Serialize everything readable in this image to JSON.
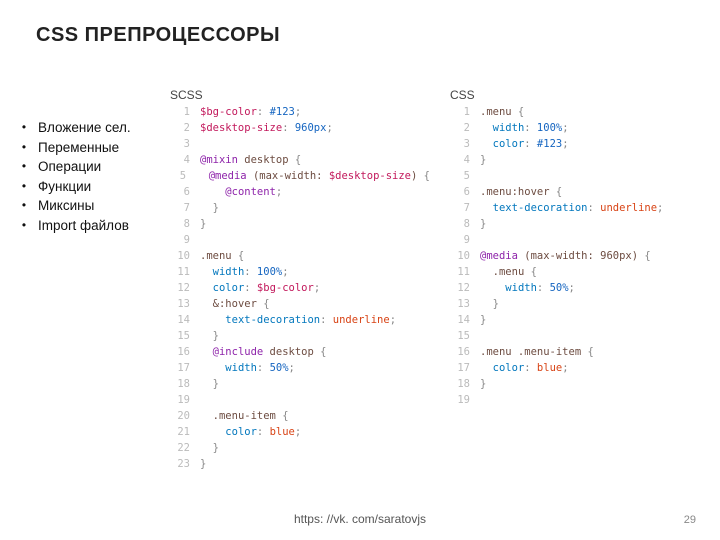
{
  "title": "CSS ПРЕПРОЦЕССОРЫ",
  "bullets": [
    "Вложение сел.",
    "Переменные",
    "Операции",
    "Функции",
    "Миксины",
    "Import файлов"
  ],
  "panels": {
    "scss": {
      "label": "SCSS"
    },
    "css": {
      "label": "CSS"
    }
  },
  "scss_code": [
    [
      {
        "t": "$bg-color",
        "c": "tok-var"
      },
      {
        "t": ": ",
        "c": "tok-brace"
      },
      {
        "t": "#123",
        "c": "tok-num"
      },
      {
        "t": ";",
        "c": "tok-brace"
      }
    ],
    [
      {
        "t": "$desktop-size",
        "c": "tok-var"
      },
      {
        "t": ": ",
        "c": "tok-brace"
      },
      {
        "t": "960px",
        "c": "tok-num"
      },
      {
        "t": ";",
        "c": "tok-brace"
      }
    ],
    [],
    [
      {
        "t": "@mixin",
        "c": "tok-kw"
      },
      {
        "t": " desktop ",
        "c": "tok-sel"
      },
      {
        "t": "{",
        "c": "tok-brace"
      }
    ],
    [
      {
        "t": "  ",
        "c": ""
      },
      {
        "t": "@media",
        "c": "tok-kw"
      },
      {
        "t": " (max-width: ",
        "c": "tok-sel"
      },
      {
        "t": "$desktop-size",
        "c": "tok-var"
      },
      {
        "t": ") ",
        "c": "tok-sel"
      },
      {
        "t": "{",
        "c": "tok-brace"
      }
    ],
    [
      {
        "t": "    ",
        "c": ""
      },
      {
        "t": "@content",
        "c": "tok-kw"
      },
      {
        "t": ";",
        "c": "tok-brace"
      }
    ],
    [
      {
        "t": "  ",
        "c": ""
      },
      {
        "t": "}",
        "c": "tok-brace"
      }
    ],
    [
      {
        "t": "}",
        "c": "tok-brace"
      }
    ],
    [],
    [
      {
        "t": ".menu",
        "c": "tok-sel"
      },
      {
        "t": " {",
        "c": "tok-brace"
      }
    ],
    [
      {
        "t": "  ",
        "c": ""
      },
      {
        "t": "width",
        "c": "tok-prop"
      },
      {
        "t": ": ",
        "c": "tok-brace"
      },
      {
        "t": "100%",
        "c": "tok-num"
      },
      {
        "t": ";",
        "c": "tok-brace"
      }
    ],
    [
      {
        "t": "  ",
        "c": ""
      },
      {
        "t": "color",
        "c": "tok-prop"
      },
      {
        "t": ": ",
        "c": "tok-brace"
      },
      {
        "t": "$bg-color",
        "c": "tok-var"
      },
      {
        "t": ";",
        "c": "tok-brace"
      }
    ],
    [
      {
        "t": "  ",
        "c": ""
      },
      {
        "t": "&:hover",
        "c": "tok-sel"
      },
      {
        "t": " {",
        "c": "tok-brace"
      }
    ],
    [
      {
        "t": "    ",
        "c": ""
      },
      {
        "t": "text-decoration",
        "c": "tok-prop"
      },
      {
        "t": ": ",
        "c": "tok-brace"
      },
      {
        "t": "underline",
        "c": "tok-val"
      },
      {
        "t": ";",
        "c": "tok-brace"
      }
    ],
    [
      {
        "t": "  ",
        "c": ""
      },
      {
        "t": "}",
        "c": "tok-brace"
      }
    ],
    [
      {
        "t": "  ",
        "c": ""
      },
      {
        "t": "@include",
        "c": "tok-kw"
      },
      {
        "t": " desktop ",
        "c": "tok-sel"
      },
      {
        "t": "{",
        "c": "tok-brace"
      }
    ],
    [
      {
        "t": "    ",
        "c": ""
      },
      {
        "t": "width",
        "c": "tok-prop"
      },
      {
        "t": ": ",
        "c": "tok-brace"
      },
      {
        "t": "50%",
        "c": "tok-num"
      },
      {
        "t": ";",
        "c": "tok-brace"
      }
    ],
    [
      {
        "t": "  ",
        "c": ""
      },
      {
        "t": "}",
        "c": "tok-brace"
      }
    ],
    [],
    [
      {
        "t": "  ",
        "c": ""
      },
      {
        "t": ".menu-item",
        "c": "tok-sel"
      },
      {
        "t": " {",
        "c": "tok-brace"
      }
    ],
    [
      {
        "t": "    ",
        "c": ""
      },
      {
        "t": "color",
        "c": "tok-prop"
      },
      {
        "t": ": ",
        "c": "tok-brace"
      },
      {
        "t": "blue",
        "c": "tok-val"
      },
      {
        "t": ";",
        "c": "tok-brace"
      }
    ],
    [
      {
        "t": "  ",
        "c": ""
      },
      {
        "t": "}",
        "c": "tok-brace"
      }
    ],
    [
      {
        "t": "}",
        "c": "tok-brace"
      }
    ]
  ],
  "css_code": [
    [
      {
        "t": ".menu",
        "c": "tok-sel"
      },
      {
        "t": " {",
        "c": "tok-brace"
      }
    ],
    [
      {
        "t": "  ",
        "c": ""
      },
      {
        "t": "width",
        "c": "tok-prop"
      },
      {
        "t": ": ",
        "c": "tok-brace"
      },
      {
        "t": "100%",
        "c": "tok-num"
      },
      {
        "t": ";",
        "c": "tok-brace"
      }
    ],
    [
      {
        "t": "  ",
        "c": ""
      },
      {
        "t": "color",
        "c": "tok-prop"
      },
      {
        "t": ": ",
        "c": "tok-brace"
      },
      {
        "t": "#123",
        "c": "tok-num"
      },
      {
        "t": ";",
        "c": "tok-brace"
      }
    ],
    [
      {
        "t": "}",
        "c": "tok-brace"
      }
    ],
    [],
    [
      {
        "t": ".menu:hover",
        "c": "tok-sel"
      },
      {
        "t": " {",
        "c": "tok-brace"
      }
    ],
    [
      {
        "t": "  ",
        "c": ""
      },
      {
        "t": "text-decoration",
        "c": "tok-prop"
      },
      {
        "t": ": ",
        "c": "tok-brace"
      },
      {
        "t": "underline",
        "c": "tok-val"
      },
      {
        "t": ";",
        "c": "tok-brace"
      }
    ],
    [
      {
        "t": "}",
        "c": "tok-brace"
      }
    ],
    [],
    [
      {
        "t": "@media",
        "c": "tok-kw"
      },
      {
        "t": " (max-width: 960px) ",
        "c": "tok-sel"
      },
      {
        "t": "{",
        "c": "tok-brace"
      }
    ],
    [
      {
        "t": "  ",
        "c": ""
      },
      {
        "t": ".menu",
        "c": "tok-sel"
      },
      {
        "t": " {",
        "c": "tok-brace"
      }
    ],
    [
      {
        "t": "    ",
        "c": ""
      },
      {
        "t": "width",
        "c": "tok-prop"
      },
      {
        "t": ": ",
        "c": "tok-brace"
      },
      {
        "t": "50%",
        "c": "tok-num"
      },
      {
        "t": ";",
        "c": "tok-brace"
      }
    ],
    [
      {
        "t": "  ",
        "c": ""
      },
      {
        "t": "}",
        "c": "tok-brace"
      }
    ],
    [
      {
        "t": "}",
        "c": "tok-brace"
      }
    ],
    [],
    [
      {
        "t": ".menu .menu-item",
        "c": "tok-sel"
      },
      {
        "t": " {",
        "c": "tok-brace"
      }
    ],
    [
      {
        "t": "  ",
        "c": ""
      },
      {
        "t": "color",
        "c": "tok-prop"
      },
      {
        "t": ": ",
        "c": "tok-brace"
      },
      {
        "t": "blue",
        "c": "tok-val"
      },
      {
        "t": ";",
        "c": "tok-brace"
      }
    ],
    [
      {
        "t": "}",
        "c": "tok-brace"
      }
    ],
    []
  ],
  "footer": "https: //vk. com/saratovjs",
  "page_number": "29"
}
